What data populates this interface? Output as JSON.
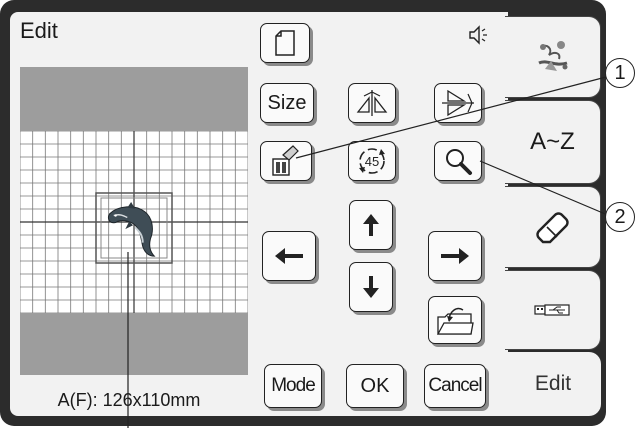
{
  "header": {
    "title": "Edit"
  },
  "status": {
    "size_text": "A(F): 126x110mm"
  },
  "buttons": {
    "size_label": "Size",
    "mode_label": "Mode",
    "ok_label": "OK",
    "cancel_label": "Cancel",
    "rotate_label": "45"
  },
  "tabs": {
    "alphabet_label": "A~Z",
    "edit_label": "Edit"
  },
  "callouts": {
    "one": "1",
    "two": "2"
  },
  "icons": [
    "page-icon",
    "speaker-icon",
    "mirror-horizontal-icon",
    "mirror-vertical-icon",
    "delete-icon",
    "rotate-icon",
    "magnify-icon",
    "arrow-up-icon",
    "arrow-down-icon",
    "arrow-left-icon",
    "arrow-right-icon",
    "open-folder-icon",
    "embroidery-pattern-icon",
    "eraser-icon",
    "usb-icon"
  ],
  "colors": {
    "frame": "#2c2c2c",
    "screen": "#f2f2f2",
    "preview_bg": "#9d9d9d"
  }
}
